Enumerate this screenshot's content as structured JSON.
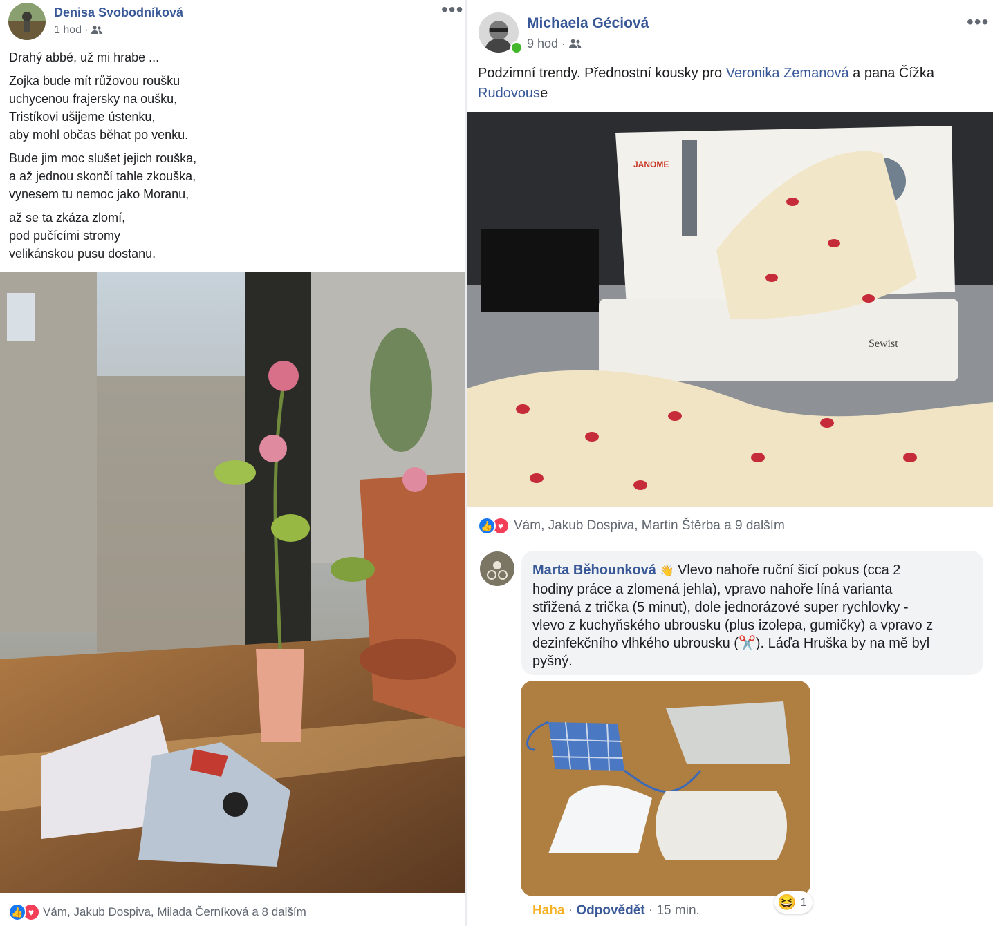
{
  "left_post": {
    "author": "Denisa Svobodníková",
    "time": "1 hod",
    "privacy_icon": "friends-icon",
    "more_label": "•••",
    "paragraphs": [
      [
        "Drahý abbé, už mi hrabe ..."
      ],
      [
        "Zojka bude mít růžovou roušku",
        "uchycenou frajersky na oušku,",
        "Tristíkovi ušijeme ústenku,",
        "aby mohl občas běhat po venku."
      ],
      [
        "Bude jim moc slušet jejich rouška,",
        "a až jednou skončí tahle zkouška,",
        "vynesem tu nemoc jako Moranu,"
      ],
      [
        "až se ta zkáza zlomí,",
        "pod pučícími stromy",
        "velikánskou pusu dostanu."
      ]
    ],
    "reactions_text": "Vám, Jakub Dospiva, Milada Černíková a 8 dalším"
  },
  "right_post": {
    "author": "Michaela Géciová",
    "time": "9 hod",
    "privacy_icon": "friends-icon",
    "more_label": "•••",
    "text_part1": "Podzimní trendy. Přednostní kousky pro ",
    "mention1": "Veronika Zemanová",
    "text_part2": " a pana Čížka",
    "mention2": "Rudovous",
    "text_part3": "e",
    "reactions_text": "Vám, Jakub Dospiva, Martin Štěrba a 9 dalším",
    "comment": {
      "author": "Marta Běhounková",
      "author_badge": "👋",
      "lines": [
        "Vlevo nahoře ruční šicí pokus (cca 2",
        "hodiny práce a zlomená jehla), vpravo nahoře líná varianta",
        "střižená z trička (5 minut), dole jednorázové super rychlovky -",
        "vlevo z kuchyňského ubrousku (plus izolepa, gumičky) a vpravo z",
        "dezinfekčního vlhkého ubrousku (✂️). Láďa Hruška by na mě byl",
        "pyšný."
      ],
      "action_haha": "Haha",
      "action_reply": "Odpovědět",
      "time": "15 min.",
      "reaction_emoji": "😆",
      "reaction_count": "1"
    }
  },
  "colors": {
    "link": "#385898",
    "meta": "#606770",
    "like": "#1877f2",
    "love": "#f33e58",
    "haha": "#f7b125"
  }
}
